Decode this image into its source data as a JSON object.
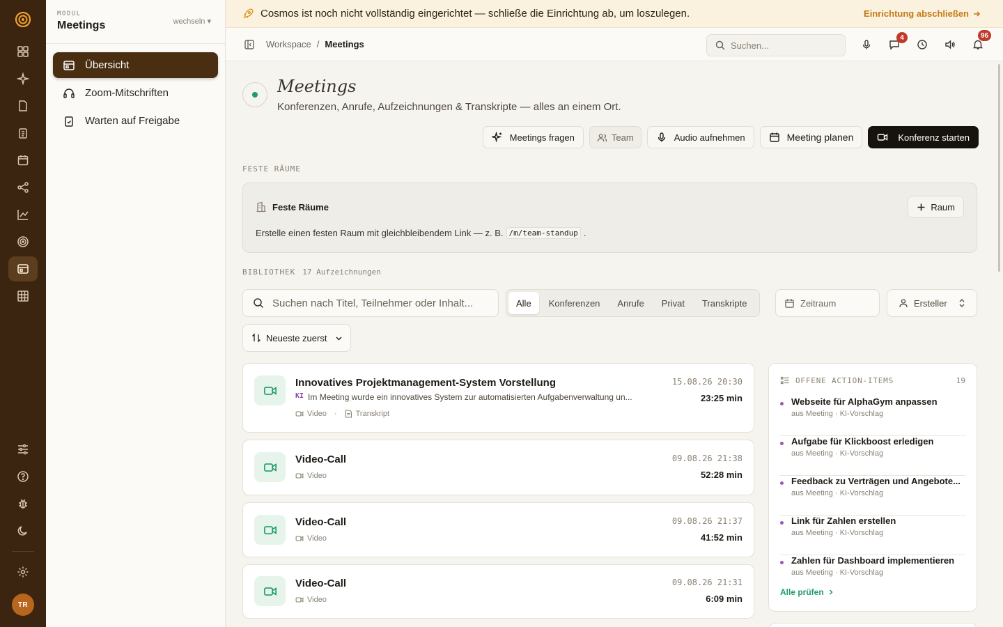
{
  "rail": {
    "avatar_initials": "TR",
    "active": "meetings"
  },
  "module": {
    "kicker": "MODUL",
    "title": "Meetings",
    "switch_label": "wechseln ▾",
    "items": [
      {
        "label": "Übersicht",
        "icon": "meeting-icon",
        "active": true
      },
      {
        "label": "Zoom-Mitschriften",
        "icon": "headset-icon",
        "active": false
      },
      {
        "label": "Warten auf Freigabe",
        "icon": "clipboard-check-icon",
        "active": false
      }
    ]
  },
  "banner": {
    "message": "Cosmos ist noch nicht vollständig eingerichtet — schließe die Einrichtung ab, um loszulegen.",
    "cta": "Einrichtung abschließen"
  },
  "topbar": {
    "breadcrumb": [
      "Workspace",
      "/",
      "Meetings"
    ],
    "search_placeholder": "Suchen...",
    "chat_badge": "4",
    "bell_badge": "96"
  },
  "hero": {
    "title": "Meetings",
    "subtitle": "Konferenzen, Anrufe, Aufzeichnungen & Transkripte — alles an einem Ort."
  },
  "actions": {
    "ask": "Meetings fragen",
    "team": "Team",
    "record": "Audio aufnehmen",
    "plan": "Meeting planen",
    "start": "Konferenz starten"
  },
  "rooms": {
    "section_label": "FESTE RÄUME",
    "title": "Feste Räume",
    "add_button": "Raum",
    "desc_before": "Erstelle einen festen Raum mit gleichbleibendem Link — z. B.",
    "desc_code": "/m/team-standup",
    "desc_after": "."
  },
  "library": {
    "section_label": "BIBLIOTHEK",
    "count": "17 Aufzeichnungen",
    "search_placeholder": "Suchen nach Titel, Teilnehmer oder Inhalt...",
    "filters": [
      "Alle",
      "Konferenzen",
      "Anrufe",
      "Privat",
      "Transkripte"
    ],
    "active_filter": "Alle",
    "range_placeholder": "Zeitraum",
    "creator_label": "Ersteller",
    "sort_label": "Neueste zuerst"
  },
  "recordings": [
    {
      "title": "Innovatives Projektmanagement-System Vorstellung",
      "date": "15.08.26 20:30",
      "duration": "23:25 min",
      "ki_tag": "KI",
      "summary": "Im Meeting wurde ein innovatives System zur automatisierten Aufgabenverwaltung un...",
      "meta": [
        "Video",
        "·",
        "Transkript"
      ]
    },
    {
      "title": "Video-Call",
      "date": "09.08.26 21:38",
      "duration": "52:28 min",
      "meta": [
        "Video"
      ]
    },
    {
      "title": "Video-Call",
      "date": "09.08.26 21:37",
      "duration": "41:52 min",
      "meta": [
        "Video"
      ]
    },
    {
      "title": "Video-Call",
      "date": "09.08.26 21:31",
      "duration": "6:09 min",
      "meta": [
        "Video"
      ]
    }
  ],
  "action_items": {
    "title": "OFFENE ACTION-ITEMS",
    "count": "19",
    "items": [
      {
        "title": "Webseite für AlphaGym anpassen",
        "source": "aus Meeting · KI-Vorschlag"
      },
      {
        "title": "Aufgabe für Klickboost erledigen",
        "source": "aus Meeting · KI-Vorschlag"
      },
      {
        "title": "Feedback zu Verträgen und Angebote...",
        "source": "aus Meeting · KI-Vorschlag"
      },
      {
        "title": "Link für Zahlen erstellen",
        "source": "aus Meeting · KI-Vorschlag"
      },
      {
        "title": "Zahlen für Dashboard implementieren",
        "source": "aus Meeting · KI-Vorschlag"
      }
    ],
    "review_all": "Alle prüfen"
  },
  "colors": {
    "rail": "#3b2410",
    "active_item": "#4a2e12",
    "accent_green": "#1f9c6a",
    "banner_cta": "#c47a12",
    "badge": "#c0392b"
  }
}
